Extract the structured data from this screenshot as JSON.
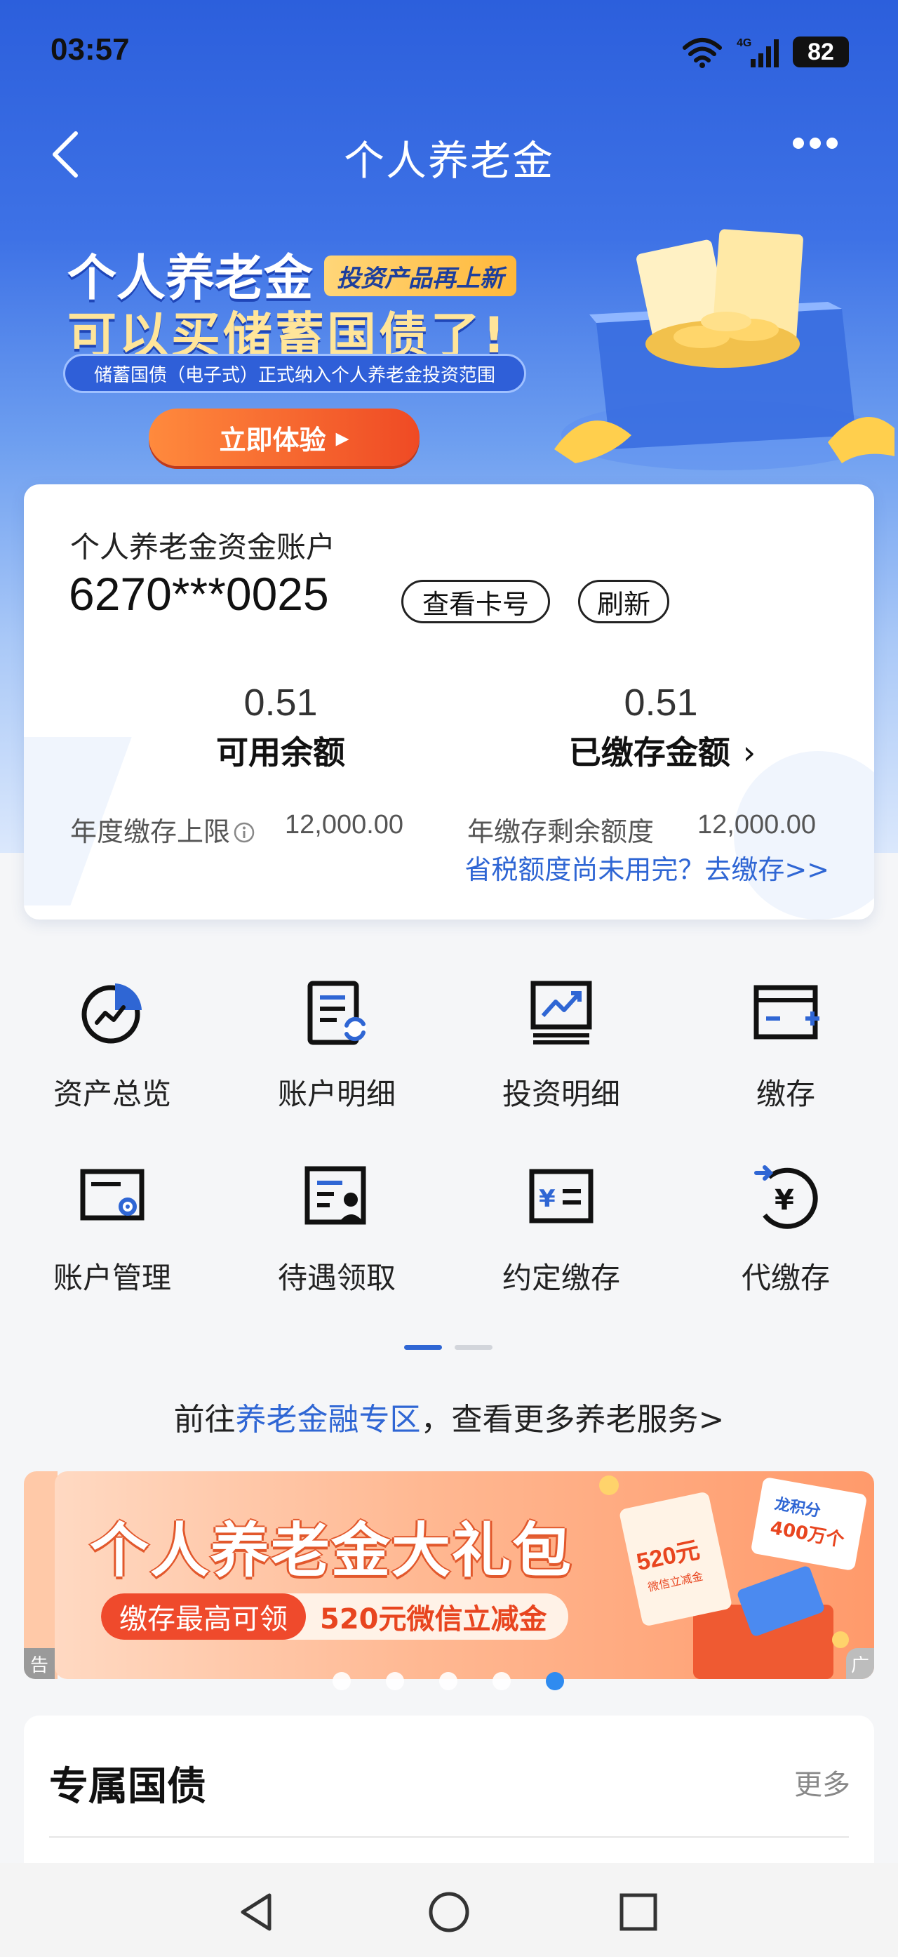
{
  "status_bar": {
    "time": "03:57",
    "network": "4G",
    "battery": "82"
  },
  "nav": {
    "title": "个人养老金",
    "back_icon": "back-arrow-icon",
    "more_icon": "more-dots-icon"
  },
  "banner": {
    "title_line1": "个人养老金",
    "badge": "投资产品再上新",
    "title_line2": "可以买储蓄国债了!",
    "subtitle": "储蓄国债（电子式）正式纳入个人养老金投资范围",
    "cta": "立即体验",
    "cta_arrow": "▸"
  },
  "account": {
    "label": "个人养老金资金账户",
    "number": "6270***0025",
    "view_card_btn": "查看卡号",
    "refresh_btn": "刷新",
    "available_value": "0.51",
    "available_label": "可用余额",
    "paid_value": "0.51",
    "paid_label": "已缴存金额",
    "paid_chevron": "›",
    "annual_limit_label": "年度缴存上限",
    "annual_limit_value": "12,000.00",
    "remaining_label": "年缴存剩余额度",
    "remaining_value": "12,000.00",
    "tax_link": "省税额度尚未用完？去缴存>>"
  },
  "grid": [
    {
      "label": "资产总览",
      "icon": "pie-chart-icon"
    },
    {
      "label": "账户明细",
      "icon": "list-refresh-icon"
    },
    {
      "label": "投资明细",
      "icon": "trend-monitor-icon"
    },
    {
      "label": "缴存",
      "icon": "card-add-icon"
    },
    {
      "label": "账户管理",
      "icon": "card-settings-icon"
    },
    {
      "label": "待遇领取",
      "icon": "document-person-icon"
    },
    {
      "label": "约定缴存",
      "icon": "yen-list-icon"
    },
    {
      "label": "代缴存",
      "icon": "yen-transfer-icon"
    }
  ],
  "promo": {
    "prefix": "前往",
    "link": "养老金融专区",
    "suffix": "，查看更多养老服务>"
  },
  "ad": {
    "title": "个人养老金大礼包",
    "sub_left": "缴存最高可领",
    "sub_right": "520元微信立减金",
    "coupon_amount": "520元",
    "coupon_label": "微信立减金",
    "points_brand": "龙积分",
    "points_amount": "400万个",
    "tag": "广",
    "prev_tag": "告",
    "slides": 5,
    "active_slide": 5
  },
  "section": {
    "title": "专属国债",
    "more": "更多"
  },
  "colors": {
    "primary": "#2f66d4",
    "hero_top": "#2c5fdc",
    "accent_orange": "#ef4a24"
  }
}
